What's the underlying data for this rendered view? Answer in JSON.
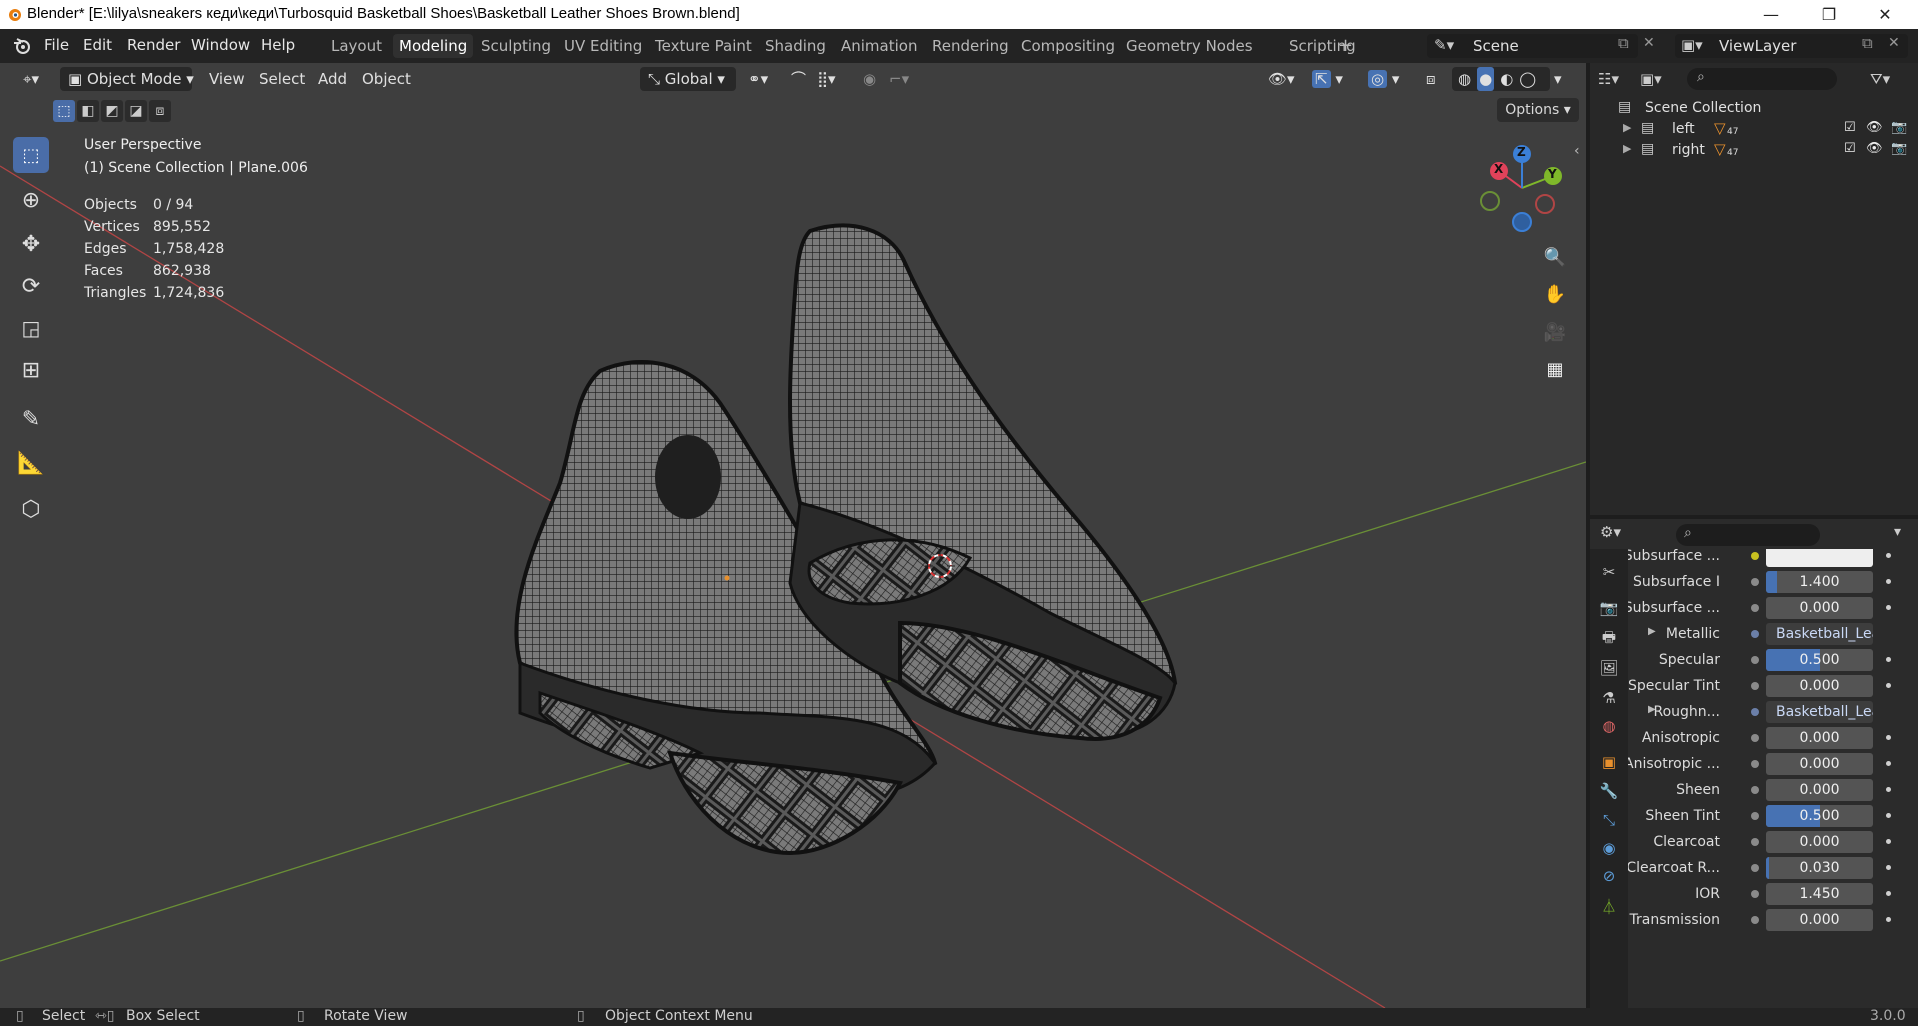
{
  "window": {
    "title": "Blender* [E:\\lilya\\sneakers кеди\\кеди\\Turbosquid Basketball Shoes\\Basketball Leather Shoes Brown.blend]",
    "minimize": "—",
    "maximize": "❐",
    "close": "✕"
  },
  "menu": [
    "File",
    "Edit",
    "Render",
    "Window",
    "Help"
  ],
  "workspaces": [
    "Layout",
    "Modeling",
    "Sculpting",
    "UV Editing",
    "Texture Paint",
    "Shading",
    "Animation",
    "Rendering",
    "Compositing",
    "Geometry Nodes",
    "Scripting"
  ],
  "active_workspace": "Modeling",
  "scene": "Scene",
  "view_layer": "ViewLayer",
  "viewport": {
    "mode": "Object Mode",
    "menus": [
      "View",
      "Select",
      "Add",
      "Object"
    ],
    "orientation": "Global",
    "options_label": "Options",
    "perspective": "User Perspective",
    "collection_info": "(1) Scene Collection | Plane.006",
    "stats": [
      {
        "label": "Objects",
        "value": "0 / 94"
      },
      {
        "label": "Vertices",
        "value": "895,552"
      },
      {
        "label": "Edges",
        "value": "1,758,428"
      },
      {
        "label": "Faces",
        "value": "862,938"
      },
      {
        "label": "Triangles",
        "value": "1,724,836"
      }
    ],
    "gizmo": {
      "x": "X",
      "y": "Y",
      "z": "Z"
    },
    "colors": {
      "x_axis": "#e0425a",
      "y_axis": "#7fb82a",
      "z_axis": "#3b7fd6",
      "active_tool": "#4a6da8"
    }
  },
  "outliner": {
    "root": "Scene Collection",
    "items": [
      {
        "name": "left",
        "badge": "47"
      },
      {
        "name": "right",
        "badge": "47"
      }
    ]
  },
  "properties": {
    "rows": [
      {
        "label": "Subsurface ...",
        "value": "",
        "type": "color"
      },
      {
        "label": "Subsurface I",
        "value": "1.400",
        "type": "num",
        "fill": 0.1
      },
      {
        "label": "Subsurface ...",
        "value": "0.000",
        "type": "num",
        "fill": 0
      },
      {
        "label": "Metallic",
        "value": "Basketball_Lea...",
        "type": "link"
      },
      {
        "label": "Specular",
        "value": "0.500",
        "type": "num",
        "fill": 0.5
      },
      {
        "label": "Specular Tint",
        "value": "0.000",
        "type": "num",
        "fill": 0
      },
      {
        "label": "Roughn...",
        "value": "Basketball_Lea...",
        "type": "link"
      },
      {
        "label": "Anisotropic",
        "value": "0.000",
        "type": "num",
        "fill": 0
      },
      {
        "label": "Anisotropic ...",
        "value": "0.000",
        "type": "num",
        "fill": 0
      },
      {
        "label": "Sheen",
        "value": "0.000",
        "type": "num",
        "fill": 0
      },
      {
        "label": "Sheen Tint",
        "value": "0.500",
        "type": "num",
        "fill": 0.5
      },
      {
        "label": "Clearcoat",
        "value": "0.000",
        "type": "num",
        "fill": 0
      },
      {
        "label": "Clearcoat R...",
        "value": "0.030",
        "type": "num",
        "fill": 0.03
      },
      {
        "label": "IOR",
        "value": "1.450",
        "type": "num",
        "fill": 0
      },
      {
        "label": "Transmission",
        "value": "0.000",
        "type": "num",
        "fill": 0
      }
    ]
  },
  "statusbar": {
    "select": "Select",
    "box_select": "Box Select",
    "rotate_view": "Rotate View",
    "context_menu": "Object Context Menu",
    "version": "3.0.0"
  }
}
